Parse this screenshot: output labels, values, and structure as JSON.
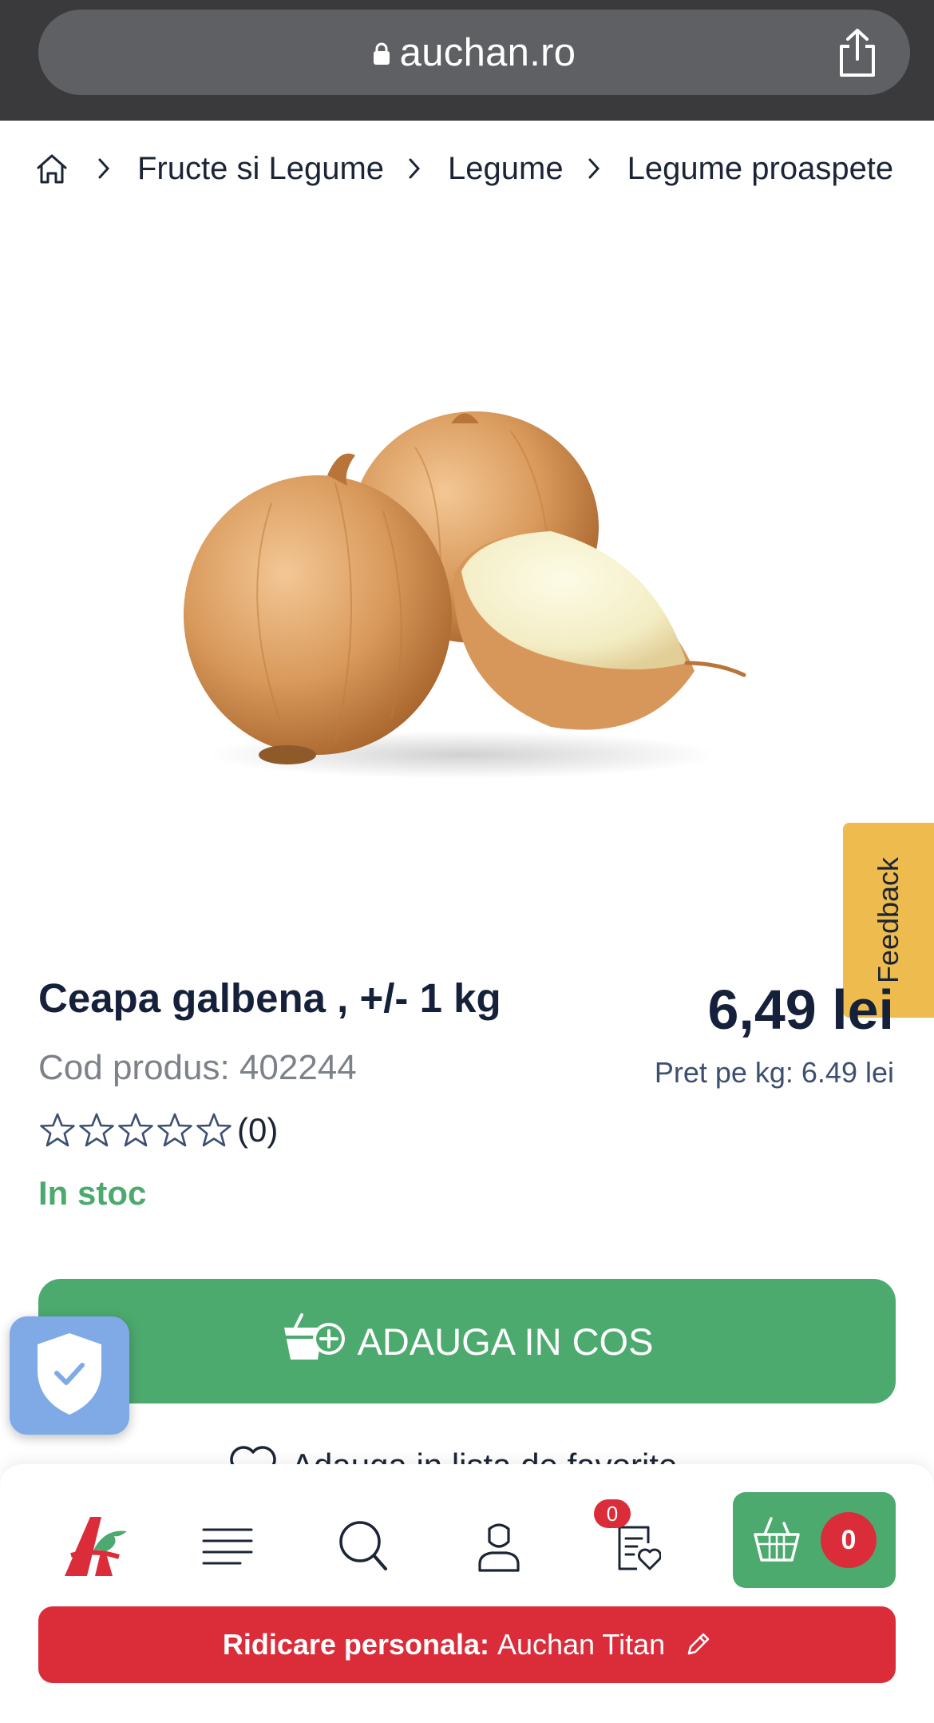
{
  "browser": {
    "url": "auchan.ro",
    "lock_icon": "lock-icon",
    "share_icon": "share-icon"
  },
  "breadcrumb": {
    "home_icon": "home-icon",
    "separator_icon": "chevron-right-icon",
    "items": [
      "Fructe si Legume",
      "Legume",
      "Legume proaspete"
    ]
  },
  "product": {
    "image_alt": "onion-product-image",
    "name": "Ceapa galbena , +/- 1 kg",
    "price": "6,49 lei",
    "code": "Cod produs: 402244",
    "unit_price": "Pret pe kg: 6.49 lei",
    "rating": {
      "stars_filled": 0,
      "stars_total": 5,
      "count_label": "(0)"
    },
    "stock": "In stoc"
  },
  "feedback": {
    "label": "Feedback"
  },
  "actions": {
    "add_to_cart": "ADAUGA IN COS",
    "add_to_cart_icon": "basket-plus-icon",
    "wishlist_partial": "Adauga in lista de favorite",
    "wishlist_icon": "heart-icon"
  },
  "privacy": {
    "icon": "shield-check-icon"
  },
  "bottom_nav": {
    "logo_icon": "auchan-logo-icon",
    "menu_icon": "menu-icon",
    "search_icon": "search-icon",
    "account_icon": "user-icon",
    "lists_icon": "list-heart-icon",
    "lists_badge": "0",
    "cart_icon": "basket-icon",
    "cart_count": "0"
  },
  "pickup": {
    "label": "Ridicare personala:",
    "store": "Auchan Titan",
    "edit_icon": "pencil-icon"
  },
  "colors": {
    "green": "#4caa6e",
    "red": "#db2c3a",
    "feedback_yellow": "#edbb4e",
    "navy_text": "#15203a"
  }
}
